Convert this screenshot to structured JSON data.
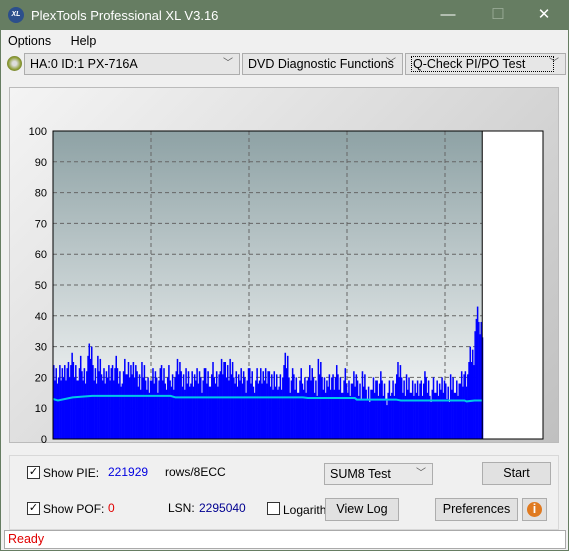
{
  "window": {
    "title": "PlexTools Professional XL V3.16",
    "logo_text": "XL",
    "minimize": "—",
    "maximize": "☐",
    "close": "✕"
  },
  "menu": [
    "Options",
    "Help"
  ],
  "toolbar": {
    "drive": "HA:0 ID:1  PX-716A",
    "function": "DVD Diagnostic Functions",
    "test": "Q-Check PI/PO Test"
  },
  "chart_data": {
    "type": "bar",
    "xlim": [
      0,
      5
    ],
    "ylim": [
      0,
      100
    ],
    "grid": true,
    "x_ticks": [
      "0",
      "1",
      "2",
      "3",
      "4",
      "5"
    ],
    "y_ticks": [
      "0",
      "10",
      "20",
      "30",
      "40",
      "50",
      "60",
      "70",
      "80",
      "90",
      "100"
    ],
    "pie_step": 0.05,
    "end_x": 4.38,
    "pie_max": [
      24,
      27,
      25,
      28,
      26,
      27,
      25,
      31,
      26,
      27,
      26,
      25,
      27,
      24,
      26,
      27,
      25,
      24,
      25,
      23,
      24,
      23,
      25,
      24,
      23,
      26,
      24,
      23,
      25,
      24,
      23,
      24,
      25,
      24,
      26,
      27,
      26,
      25,
      24,
      23,
      24,
      23,
      25,
      23,
      24,
      22,
      24,
      29,
      23,
      22,
      23,
      22,
      24,
      22,
      26,
      23,
      22,
      24,
      22,
      23,
      21,
      22,
      21,
      22,
      20,
      21,
      22,
      20,
      19,
      21,
      25,
      22,
      21,
      22,
      20,
      22,
      21,
      20,
      21,
      20,
      20,
      21,
      22,
      23,
      25,
      31,
      43,
      40
    ],
    "po_line": [
      [
        0,
        13
      ],
      [
        0.05,
        12.5
      ],
      [
        0.2,
        13.5
      ],
      [
        0.4,
        14
      ],
      [
        1.2,
        14
      ],
      [
        1.25,
        13.5
      ],
      [
        2.55,
        13.5
      ],
      [
        2.6,
        13.3
      ],
      [
        3.08,
        13.3
      ],
      [
        3.1,
        12.8
      ],
      [
        3.5,
        12.8
      ],
      [
        3.55,
        12.5
      ],
      [
        4.2,
        12.5
      ],
      [
        4.22,
        12.2
      ],
      [
        4.3,
        12.5
      ],
      [
        4.38,
        12.5
      ]
    ],
    "colors": {
      "pie": "#0000ff",
      "po": "#00c8e8"
    }
  },
  "controls": {
    "show_pie_label": "Show PIE:",
    "pie_value": "221929",
    "pie_unit": "rows/8ECC",
    "show_pof_label": "Show POF:",
    "pof_value": "0",
    "lsn_label": "LSN:",
    "lsn_value": "2295040",
    "log_label": "Logarithmic",
    "test_select": "SUM8 Test",
    "start": "Start",
    "view_log": "View Log",
    "preferences": "Preferences",
    "show_pie": true,
    "show_pof": true,
    "logarithmic": false
  },
  "status": "Ready"
}
